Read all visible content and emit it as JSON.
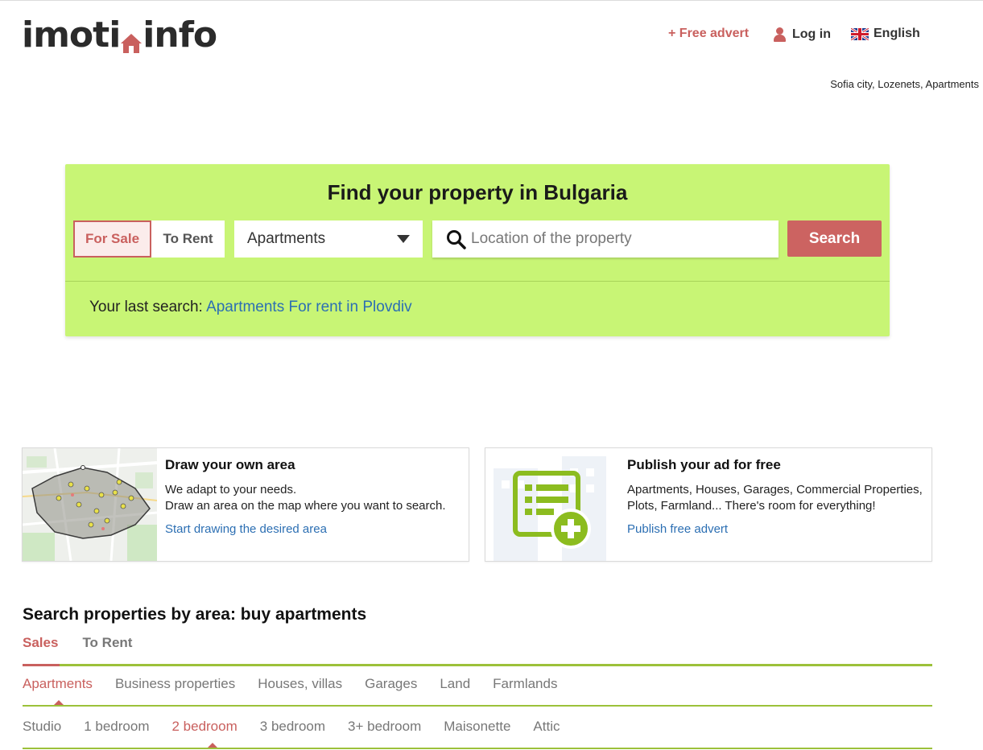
{
  "header": {
    "logo_part1": "imoti",
    "logo_part2": "info",
    "free_advert": "+ Free advert",
    "login": "Log in",
    "language": "English",
    "breadcrumb": "Sofia city, Lozenets, Apartments"
  },
  "search": {
    "title": "Find your property in Bulgaria",
    "tab_sale": "For Sale",
    "tab_rent": "To Rent",
    "property_type": "Apartments",
    "location_placeholder": "Location of the property",
    "button": "Search",
    "last_search_label": "Your last search:",
    "last_search_link": "Apartments For rent in Plovdiv"
  },
  "cards": [
    {
      "title": "Draw your own area",
      "line1": "We adapt to your needs.",
      "line2": "Draw an area on the map where you want to search.",
      "link": "Start drawing the desired area"
    },
    {
      "title": "Publish your ad for free",
      "text": "Apartments, Houses, Garages, Commercial Properties, Plots, Farmland... There's room for everything!",
      "link": "Publish free advert"
    }
  ],
  "area_section": {
    "title": "Search properties by area: buy apartments",
    "mode_tabs": [
      "Sales",
      "To Rent"
    ],
    "property_types": [
      "Apartments",
      "Business properties",
      "Houses, villas",
      "Garages",
      "Land",
      "Farmlands"
    ],
    "room_types": [
      "Studio",
      "1 bedroom",
      "2 bedroom",
      "3 bedroom",
      "3+ bedroom",
      "Maisonette",
      "Attic"
    ]
  },
  "colors": {
    "accent": "#c9605e",
    "search_bg": "#c8f575",
    "link": "#2c6fb3",
    "divider_green": "#9cc13a"
  }
}
